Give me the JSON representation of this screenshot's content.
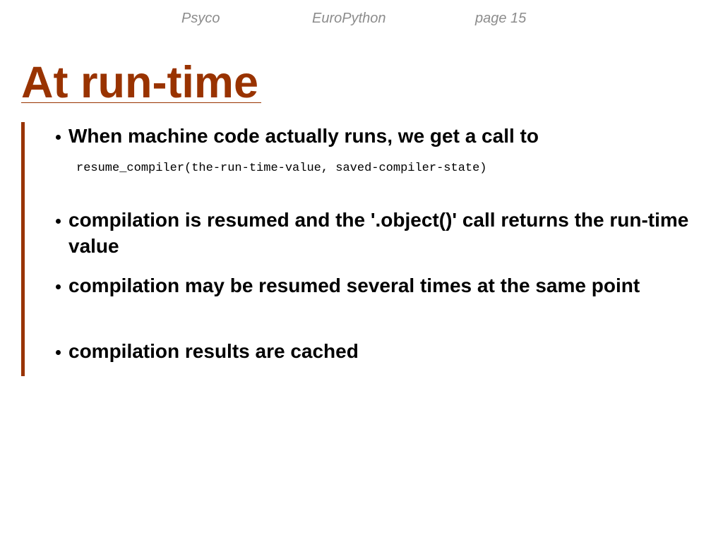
{
  "header": {
    "left": "Psyco",
    "center": "EuroPython",
    "right": "page 15"
  },
  "slide": {
    "title": "At run-time",
    "bullets": [
      "When machine code actually runs, we get a call to",
      "compilation is resumed and the '.object()' call returns the run-time value",
      "compilation may be resumed several times at the same point",
      "compilation results are cached"
    ],
    "code": "resume_compiler(the-run-time-value, saved-compiler-state)"
  },
  "colors": {
    "accent": "#993300",
    "header_text": "#8c8c8c",
    "body_text": "#000000",
    "background": "#ffffff"
  }
}
